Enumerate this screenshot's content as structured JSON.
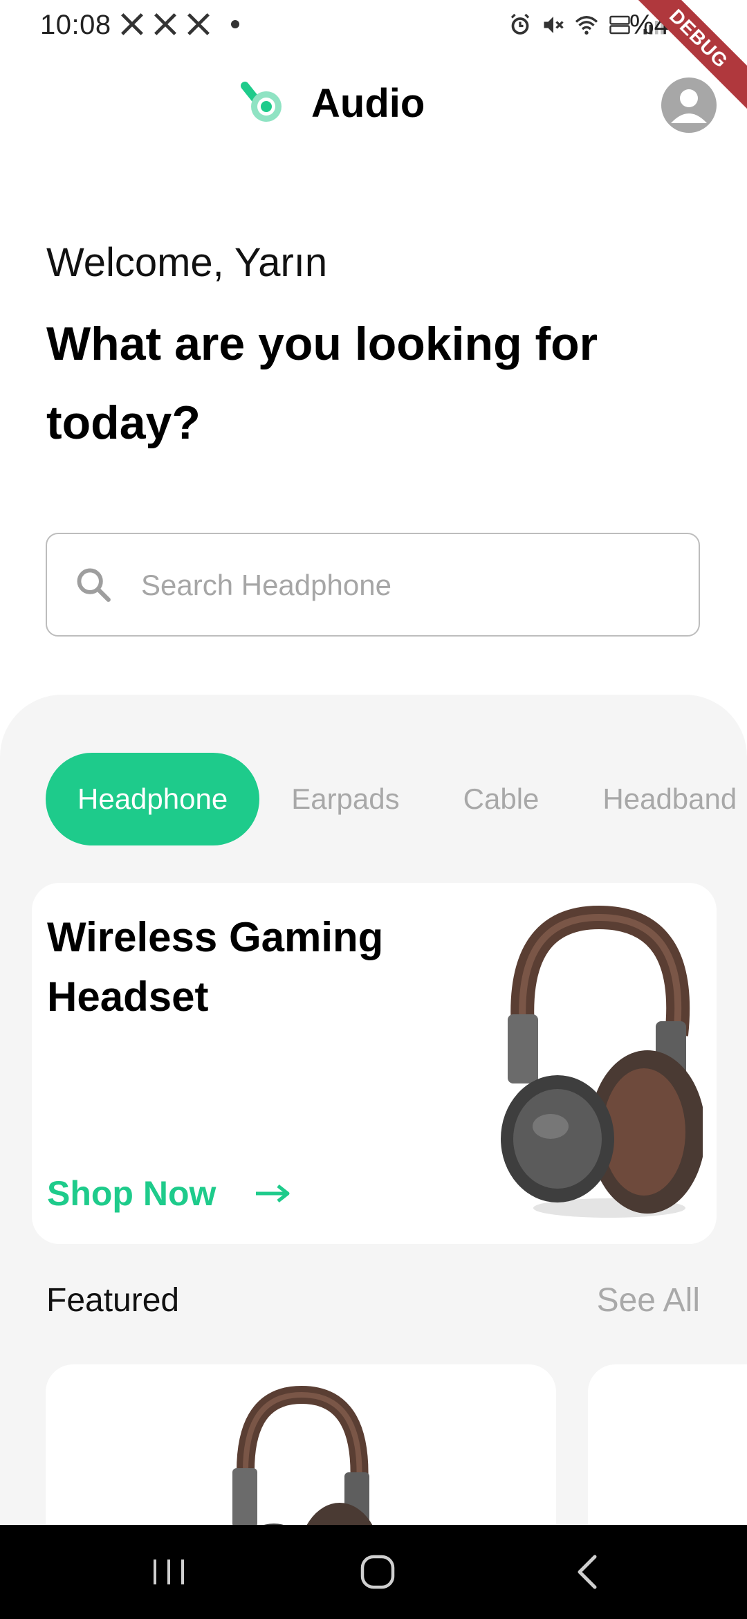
{
  "status_bar": {
    "time": "10:08",
    "battery_text": "%40",
    "debug_label": "DEBUG",
    "left_icons": [
      "x-icon",
      "x-icon",
      "x-icon",
      "dot-icon"
    ],
    "right_icons": [
      "alarm-icon",
      "mute-icon",
      "wifi-icon",
      "volte-icon",
      "signal-icon"
    ]
  },
  "app_bar": {
    "title": "Audio",
    "logo_icon": "headphone-logo-icon",
    "avatar_icon": "user-avatar-icon"
  },
  "welcome": {
    "greeting": "Welcome, Yarın",
    "headline": "What are you looking for today?"
  },
  "search": {
    "placeholder": "Search Headphone",
    "value": ""
  },
  "categories": {
    "active_index": 0,
    "items": [
      "Headphone",
      "Earpads",
      "Cable",
      "Headband"
    ]
  },
  "promo": {
    "title": "Wireless Gaming Headset",
    "cta": "Shop Now"
  },
  "featured": {
    "title": "Featured",
    "see_all": "See All"
  },
  "colors": {
    "accent": "#1ecb8b",
    "panel_background": "#f5f5f5",
    "debug_ribbon": "#b0383d"
  },
  "nav_bar": {
    "buttons": [
      "recents-icon",
      "home-icon",
      "back-icon"
    ]
  }
}
